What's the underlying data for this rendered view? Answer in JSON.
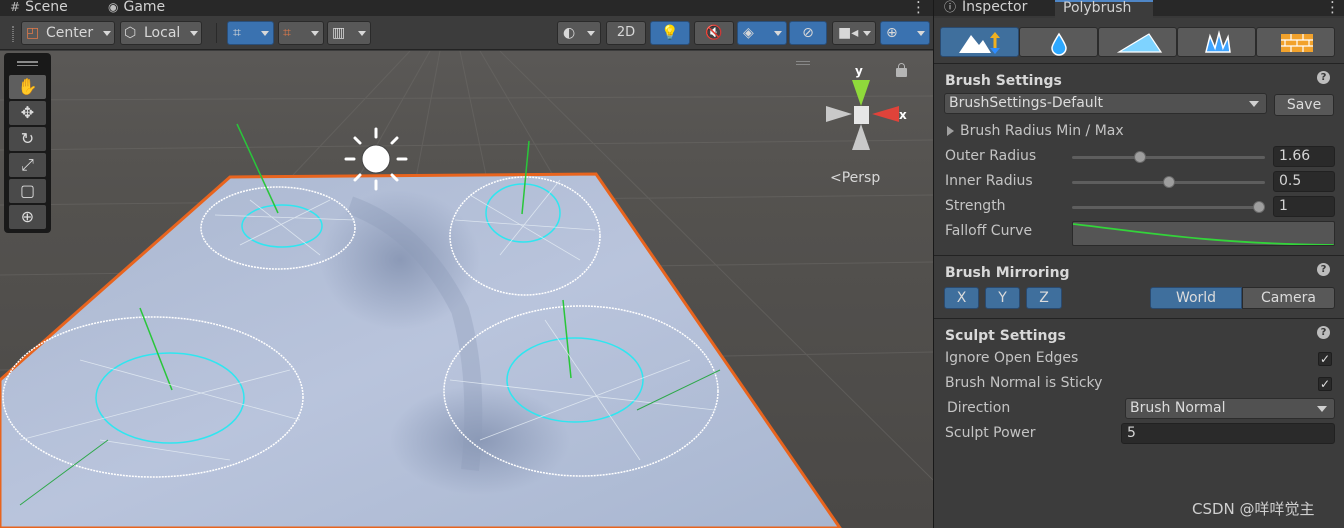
{
  "scene": {
    "tabs": {
      "scene": "Scene",
      "game": "Game"
    },
    "toolbar": {
      "pivot_label": "Center",
      "space_label": "Local",
      "two_d_label": "2D"
    },
    "view_label": "Persp",
    "gizmo_axes": {
      "y": "y",
      "x": "x"
    },
    "tools": [
      "hand-tool",
      "move-tool",
      "rotate-tool",
      "scale-tool",
      "rect-tool",
      "transform-tool"
    ]
  },
  "inspector": {
    "tabs": {
      "inspector": "Inspector",
      "polybrush": "Polybrush"
    },
    "modes": [
      "sculpt-mode",
      "smooth-mode",
      "paint-vertex-mode",
      "prefab-mode",
      "texture-mode"
    ],
    "brush_settings": {
      "title": "Brush Settings",
      "preset": "BrushSettings-Default",
      "save_label": "Save",
      "radius_foldout": "Brush Radius Min / Max",
      "outer_radius_label": "Outer Radius",
      "outer_radius_value": "1.66",
      "outer_radius_fraction": 0.34,
      "inner_radius_label": "Inner Radius",
      "inner_radius_value": "0.5",
      "inner_radius_fraction": 0.5,
      "strength_label": "Strength",
      "strength_value": "1",
      "strength_fraction": 1.0,
      "falloff_label": "Falloff Curve"
    },
    "brush_mirroring": {
      "title": "Brush Mirroring",
      "axes": [
        "X",
        "Y",
        "Z"
      ],
      "space_world": "World",
      "space_camera": "Camera",
      "selected_space": "World"
    },
    "sculpt_settings": {
      "title": "Sculpt Settings",
      "ignore_open_edges_label": "Ignore Open Edges",
      "ignore_open_edges": true,
      "normal_sticky_label": "Brush Normal is Sticky",
      "normal_sticky": true,
      "direction_label": "Direction",
      "direction_value": "Brush Normal",
      "power_label": "Sculpt Power",
      "power_value": "5"
    }
  },
  "watermark": "CSDN @咩咩觉主",
  "colors": {
    "accent_blue": "#3f6f9d",
    "selection_outline": "#e8641e",
    "brush_cyan": "#2fe6f0",
    "normal_green": "#29c63a"
  }
}
